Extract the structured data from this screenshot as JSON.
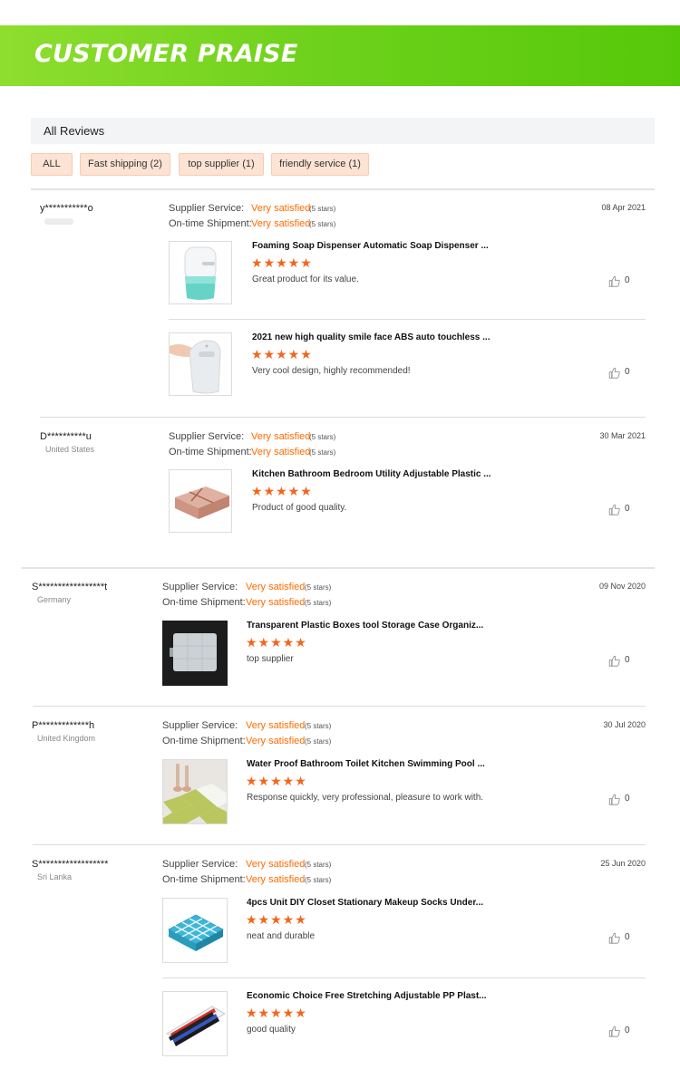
{
  "banner": {
    "title": "CUSTOMER PRAISE"
  },
  "filter": {
    "all_reviews": "All Reviews",
    "chips": [
      "ALL",
      "Fast shipping (2)",
      "top supplier (1)",
      "friendly service (1)"
    ]
  },
  "labels": {
    "supplier_service": "Supplier Service:",
    "ontime_shipment": "On-time Shipment:",
    "very_satisfied": "Very satisfied",
    "five_stars": "(5 stars)"
  },
  "reviews": [
    {
      "user": "y***********o",
      "country": "",
      "date": "08 Apr 2021",
      "products": [
        {
          "title": "Foaming Soap Dispenser Automatic Soap Dispenser ...",
          "rating": 5,
          "comment": "Great product for its value.",
          "likes": "0"
        },
        {
          "title": "2021 new high quality smile face ABS auto touchless ...",
          "rating": 5,
          "comment": "Very cool design, highly recommended!",
          "likes": "0"
        }
      ]
    },
    {
      "user": "D**********u",
      "country": "United States",
      "date": "30 Mar 2021",
      "products": [
        {
          "title": "Kitchen Bathroom Bedroom Utility Adjustable Plastic ...",
          "rating": 5,
          "comment": "Product of good quality.",
          "likes": "0"
        }
      ]
    },
    {
      "user": "S*****************t",
      "country": "Germany",
      "date": "09 Nov 2020",
      "products": [
        {
          "title": "Transparent Plastic Boxes tool Storage Case Organiz...",
          "rating": 5,
          "comment": "top supplier",
          "likes": "0"
        }
      ]
    },
    {
      "user": "P*************h",
      "country": "United Kingdom",
      "date": "30 Jul 2020",
      "products": [
        {
          "title": "Water Proof Bathroom Toilet Kitchen Swimming Pool ...",
          "rating": 5,
          "comment": "Response quickly, very professional, pleasure to work with.",
          "likes": "0"
        }
      ]
    },
    {
      "user": "S******************",
      "country": "Sri Lanka",
      "date": "25 Jun 2020",
      "products": [
        {
          "title": "4pcs Unit DIY Closet Stationary Makeup Socks Under...",
          "rating": 5,
          "comment": "neat and durable",
          "likes": "0"
        },
        {
          "title": "Economic Choice Free Stretching Adjustable PP Plast...",
          "rating": 5,
          "comment": "good quality",
          "likes": "0"
        }
      ]
    }
  ],
  "colors": {
    "accent": "#ff6a00",
    "star": "#f2661b",
    "banner": "#6fd21c",
    "chip": "#fde3d4"
  },
  "icons": {
    "like": "thumbs-up-icon",
    "star": "star-icon"
  }
}
